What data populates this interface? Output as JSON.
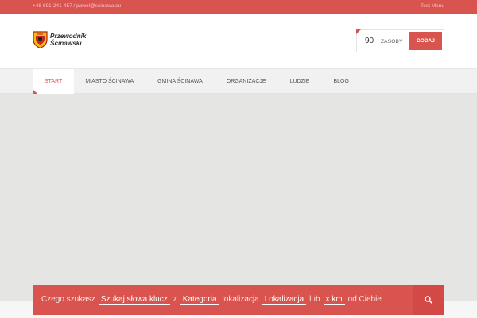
{
  "topbar": {
    "contact": "+48 691-241-457 / pawel@scinawa.eu",
    "menu": "Test Menu"
  },
  "logo": {
    "line1": "Przewodnik",
    "line2": "Ścinawski"
  },
  "resources": {
    "count": "90",
    "label": "ZASOBY",
    "add_label": "DODAJ"
  },
  "nav": {
    "items": [
      {
        "label": "START"
      },
      {
        "label": "MIASTO ŚCINAWA"
      },
      {
        "label": "GMINA ŚCINAWA"
      },
      {
        "label": "ORGANIZACJE"
      },
      {
        "label": "LUDZIE"
      },
      {
        "label": "BLOG"
      }
    ]
  },
  "search": {
    "prefix": "Czego szukasz",
    "keyword_placeholder": "Szukaj słowa klucz",
    "from": "z",
    "category": "Kategoria",
    "location_word": "lokalizacja",
    "location": "Lokalizacja",
    "or": "lub",
    "distance": "x km",
    "suffix": "od Ciebie"
  },
  "colors": {
    "accent": "#d9534f",
    "nav_bg": "#f1f1f1",
    "map_bg": "#e5e5e3"
  },
  "icons": {
    "logo": "coat-of-arms-icon",
    "search": "search-icon"
  }
}
